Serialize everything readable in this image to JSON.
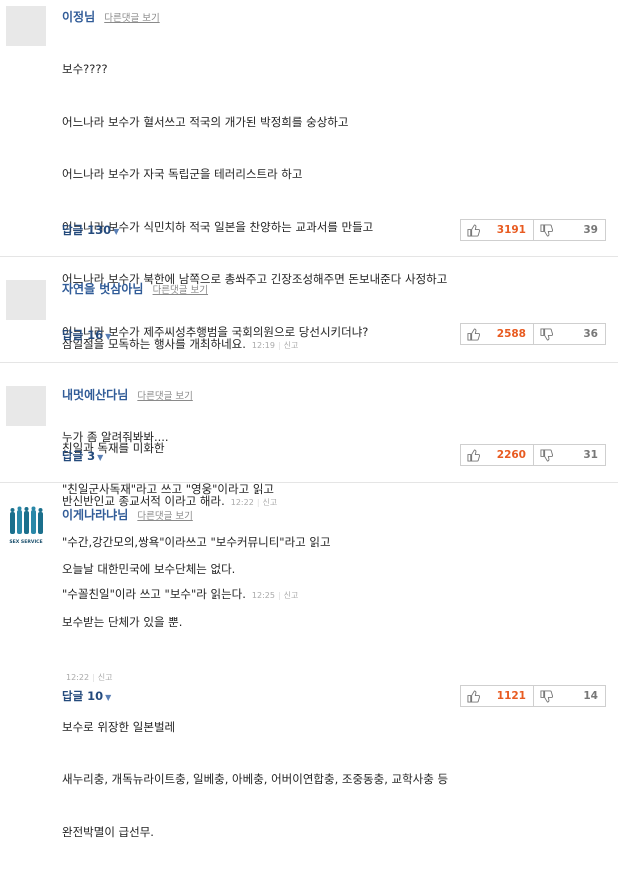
{
  "comments": [
    {
      "author": "이정님",
      "other_link": "다른댓글 보기",
      "lines": [
        "보수????",
        "어느나라 보수가 혈서쓰고 적국의 개가된 박정희를 숭상하고",
        "어느나라 보수가 자국 독립군을 테러리스트라 하고",
        "어느나라 보수가 식민치하 적국 일본을 찬양하는 교과서를 만들고",
        "어느나라 보수가 북한에 남쪽으로 총쏴주고 긴장조성해주면 돈보내준다 사정하고",
        "어느나라 보수가 제주씨성추행범을 국회의원으로 당선시키더냐?",
        "",
        "누가 좀 알려줘봐봐....",
        "\"친일군사독재\"라고 쓰고 \"영웅\"이라고 읽고",
        "\"수간,강간모의,쌍욕\"이라쓰고 \"보수커뮤니티\"라고 읽고",
        "\"수꼴친일\"이라 쓰고 \"보수\"라 읽는다."
      ],
      "time": "12:25",
      "report": "신고",
      "reply_label": "답글 130",
      "likes": "3191",
      "dislikes": "39",
      "avatar": "default-avatar"
    },
    {
      "author": "자연을 벗삼아님",
      "other_link": "다른댓글 보기",
      "lines": [
        "삼일절을 모독하는 행사를 개최하네요."
      ],
      "time": "12:19",
      "report": "신고",
      "reply_label": "답글 16",
      "likes": "2588",
      "dislikes": "36",
      "avatar": "default-avatar"
    },
    {
      "author": "내멋에산다님",
      "other_link": "다른댓글 보기",
      "lines": [
        "친일과 독재를 미화한",
        "반신반인교 종교서적 이라고 해라."
      ],
      "time": "12:22",
      "report": "신고",
      "reply_label": "답글 3",
      "likes": "2260",
      "dislikes": "31",
      "avatar": "default-avatar"
    },
    {
      "author": "이게나라냐님",
      "other_link": "다른댓글 보기",
      "lines": [
        "오늘날 대한민국에 보수단체는 없다.",
        "보수받는 단체가 있을 뿐.",
        "",
        "보수로 위장한 일본벌레",
        "새누리충, 개독뉴라이트충, 일베충, 아베충, 어버이연합충, 조중동충, 교학사충 등",
        "완전박멸이 급선무.",
        "",
        ""
      ],
      "time": "12:22",
      "report": "신고",
      "reply_label": "답글 10",
      "likes": "1121",
      "dislikes": "14",
      "avatar": "sex-service-avatar",
      "avatar_text": "SEX SERVICE",
      "avatar_colors": [
        "#1b6f8c",
        "#2a88a8"
      ]
    }
  ]
}
